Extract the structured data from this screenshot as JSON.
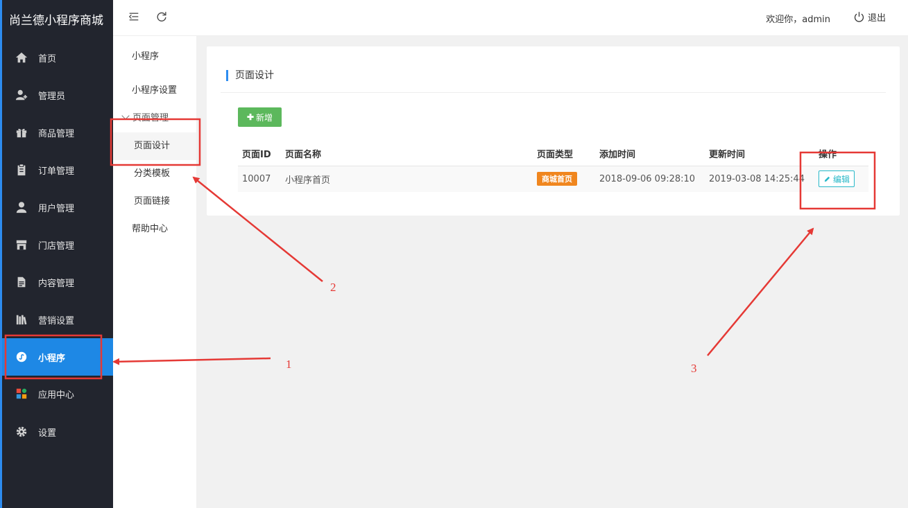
{
  "brand": "尚兰德小程序商城",
  "nav": [
    {
      "label": "首页",
      "icon": "home-icon"
    },
    {
      "label": "管理员",
      "icon": "admin-user-icon"
    },
    {
      "label": "商品管理",
      "icon": "gift-icon"
    },
    {
      "label": "订单管理",
      "icon": "clipboard-icon"
    },
    {
      "label": "用户管理",
      "icon": "user-icon"
    },
    {
      "label": "门店管理",
      "icon": "store-icon"
    },
    {
      "label": "内容管理",
      "icon": "document-icon"
    },
    {
      "label": "营销设置",
      "icon": "books-icon"
    },
    {
      "label": "小程序",
      "icon": "mini-program-icon",
      "active": true
    },
    {
      "label": "应用中心",
      "icon": "apps-icon"
    },
    {
      "label": "设置",
      "icon": "gear-icon"
    }
  ],
  "submenu": {
    "title": "小程序",
    "items": [
      {
        "label": "小程序设置"
      },
      {
        "label": "页面管理",
        "group": true
      },
      {
        "label": "页面设计",
        "active": true
      },
      {
        "label": "分类模板"
      },
      {
        "label": "页面链接"
      },
      {
        "label": "帮助中心"
      }
    ]
  },
  "header": {
    "welcome": "欢迎你，admin",
    "logout": "退出"
  },
  "page": {
    "title": "页面设计",
    "add_button": "新增",
    "table": {
      "columns": [
        "页面ID",
        "页面名称",
        "页面类型",
        "添加时间",
        "更新时间",
        "操作"
      ],
      "rows": [
        {
          "id": "10007",
          "name": "小程序首页",
          "type": "商城首页",
          "created": "2018-09-06 09:28:10",
          "updated": "2019-03-08 14:25:44",
          "action": "编辑"
        }
      ]
    }
  },
  "annotations": [
    "1",
    "2",
    "3"
  ],
  "colors": {
    "sidebar_bg": "#22252e",
    "active_blue": "#1e88e5",
    "add_green": "#5cb85c",
    "badge_orange": "#f0861e",
    "edit_teal": "#27b8c8",
    "annotation_red": "#e53935"
  }
}
